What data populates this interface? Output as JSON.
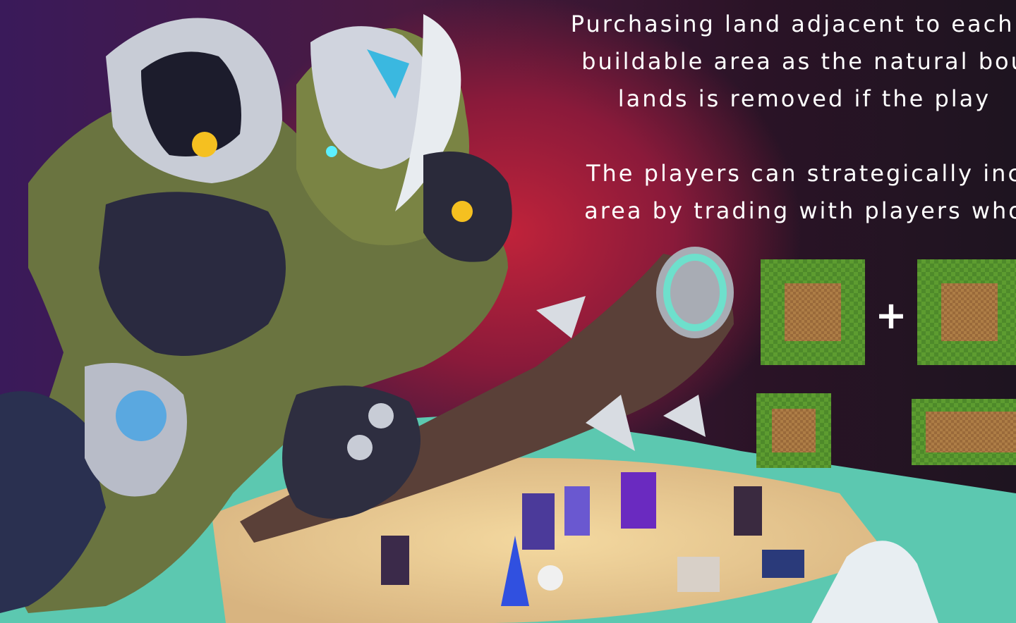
{
  "description_text": {
    "line1": "Purchasing land adjacent to each c",
    "line2": "buildable area as the natural bou",
    "line3": "lands is removed if the play",
    "line4": "The players can strategically inc",
    "line5": "area by trading with players who"
  },
  "symbols": {
    "plus": "+"
  },
  "colors": {
    "text": "#ffffff",
    "grass": "#4e8a2a",
    "dirt": "#9a6a3a",
    "background_red": "#c0233a"
  }
}
